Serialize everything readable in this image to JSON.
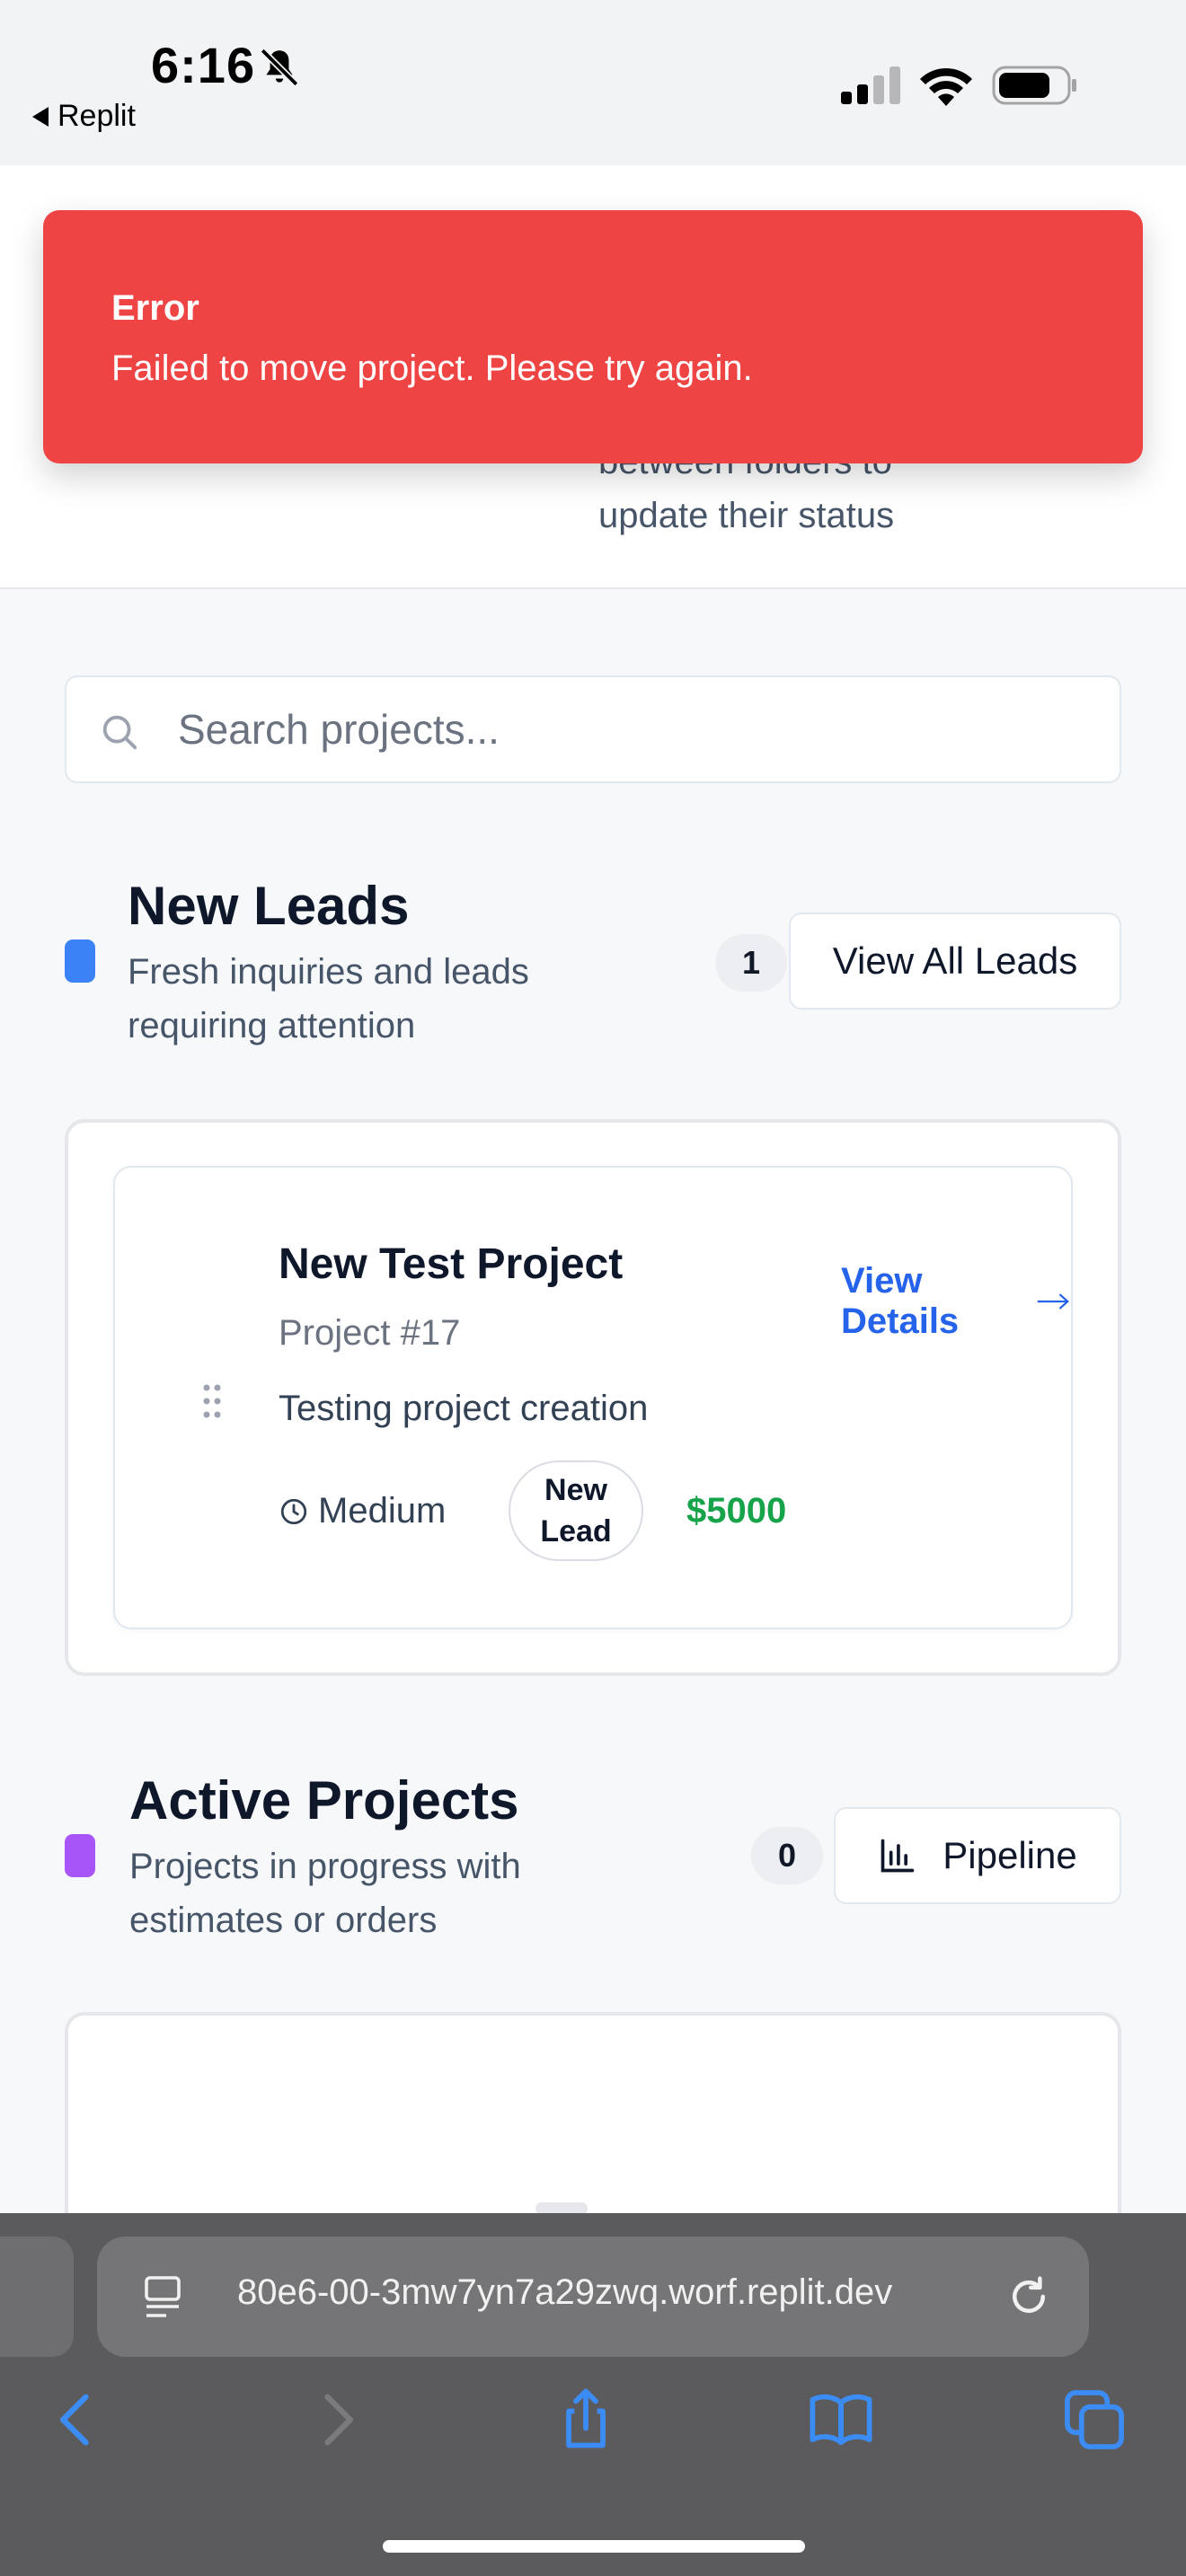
{
  "status_bar": {
    "time": "6:16",
    "back_label": "Replit"
  },
  "header": {
    "subtitle": "between folders to update their status"
  },
  "toast": {
    "title": "Error",
    "message": "Failed to move project. Please try again.",
    "color": "#ef4444"
  },
  "search": {
    "placeholder": "Search projects..."
  },
  "sections": [
    {
      "title": "New Leads",
      "description": "Fresh inquiries and leads requiring attention",
      "count": "1",
      "button_label": "View All Leads",
      "accent": "#3b82f6",
      "projects": [
        {
          "title": "New Test Project",
          "number": "Project #17",
          "description": "Testing project creation",
          "priority": "Medium",
          "status": "New Lead",
          "amount": "$5000",
          "link": "View Details"
        }
      ]
    },
    {
      "title": "Active Projects",
      "description": "Projects in progress with estimates or orders",
      "count": "0",
      "button_label": "Pipeline",
      "button_icon": "bar-chart-icon",
      "accent": "#a855f7",
      "projects": []
    }
  ],
  "browser": {
    "url": "80e6-00-3mw7yn7a29zwq.worf.replit.dev"
  }
}
